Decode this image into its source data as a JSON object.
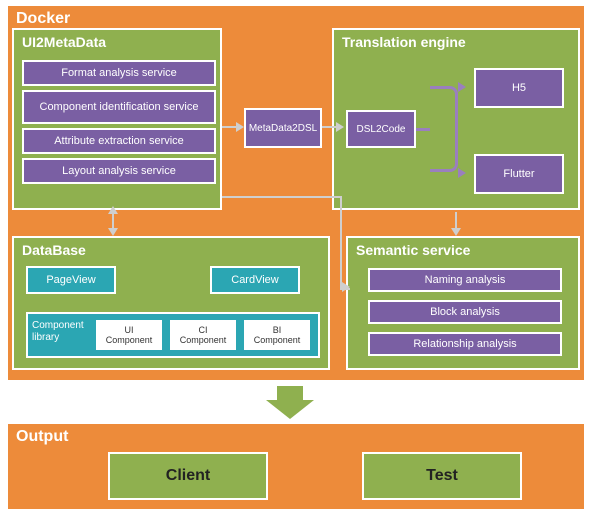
{
  "docker": {
    "title": "Docker"
  },
  "ui2meta": {
    "title": "UI2MetaData",
    "items": [
      "Format analysis service",
      "Component identification service",
      "Attribute extraction service",
      "Layout analysis service"
    ]
  },
  "metadata2dsl": "MetaData2DSL",
  "translation": {
    "title": "Translation engine",
    "dsl2code": "DSL2Code",
    "h5": "H5",
    "flutter": "Flutter"
  },
  "database": {
    "title": "DataBase",
    "pageview": "PageView",
    "cardview": "CardView",
    "complib": "Component library",
    "ui_comp": "UI Component",
    "ci_comp": "CI Component",
    "bi_comp": "BI Component"
  },
  "semantic": {
    "title": "Semantic service",
    "items": [
      "Naming analysis",
      "Block analysis",
      "Relationship analysis"
    ]
  },
  "output": {
    "title": "Output",
    "client": "Client",
    "test": "Test"
  }
}
